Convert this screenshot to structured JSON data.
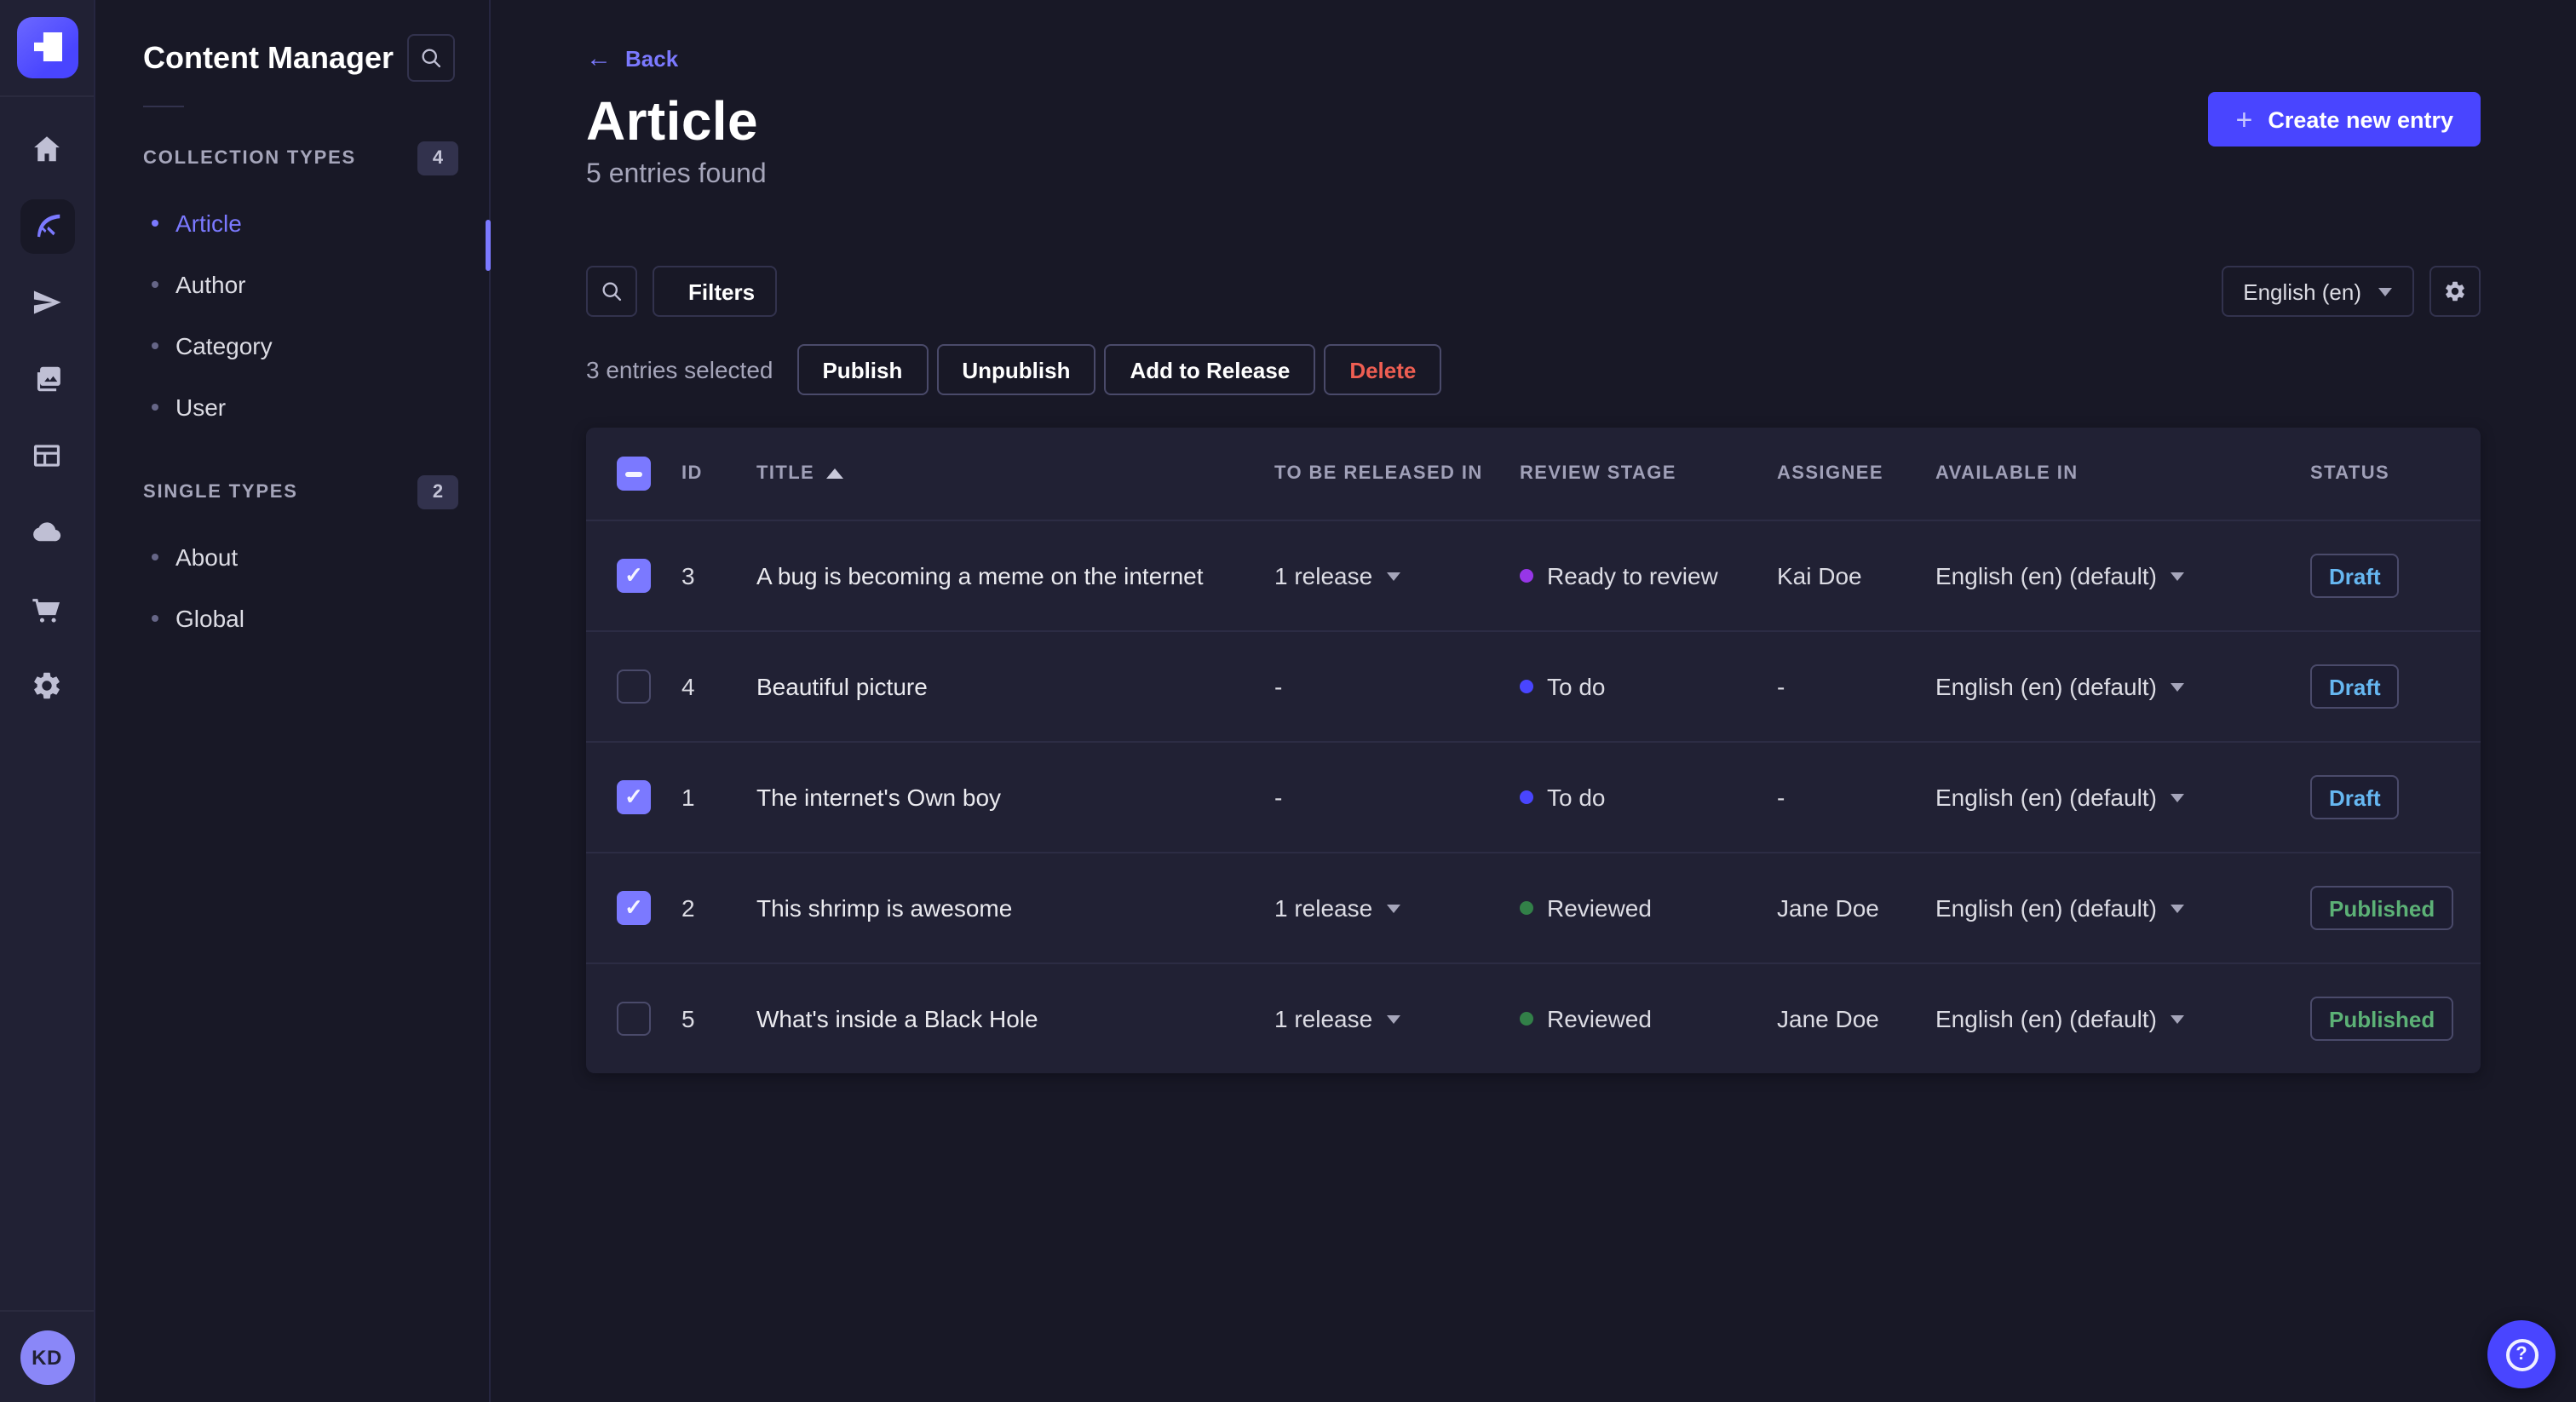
{
  "colors": {
    "primary": "#4945ff",
    "primary_light": "#7b79ff",
    "page_bg": "#181826",
    "card_bg": "#212134",
    "border": "#32324d",
    "text_muted": "#a5a5ba",
    "draft": "#66b7f1",
    "published": "#5cb176",
    "danger": "#ee5e52",
    "stage_todo": "#4945ff",
    "stage_ready": "#9736e8",
    "stage_reviewed": "#328048"
  },
  "rail": {
    "items": [
      "home",
      "content-manager",
      "releases",
      "media-library",
      "content-type-builder",
      "deploy",
      "marketplace",
      "settings"
    ],
    "active_item": "content-manager",
    "user_initials": "KD"
  },
  "subnav": {
    "title": "Content Manager",
    "sections": [
      {
        "label": "COLLECTION TYPES",
        "count": "4",
        "items": [
          {
            "label": "Article"
          },
          {
            "label": "Author"
          },
          {
            "label": "Category"
          },
          {
            "label": "User"
          }
        ],
        "active_item": "Article"
      },
      {
        "label": "SINGLE TYPES",
        "count": "2",
        "items": [
          {
            "label": "About"
          },
          {
            "label": "Global"
          }
        ]
      }
    ]
  },
  "header": {
    "back_label": "Back",
    "title": "Article",
    "subtitle": "5 entries found",
    "create_button": "Create new entry"
  },
  "toolbar": {
    "filters_label": "Filters",
    "locale": "English (en)"
  },
  "selection": {
    "text": "3 entries selected",
    "publish": "Publish",
    "unpublish": "Unpublish",
    "add_to_release": "Add to Release",
    "delete": "Delete"
  },
  "table": {
    "header_checkbox_state": "indeterminate",
    "columns": {
      "id": "ID",
      "title": "TITLE",
      "released": "TO BE RELEASED IN",
      "review": "REVIEW STAGE",
      "assignee": "ASSIGNEE",
      "available": "AVAILABLE IN",
      "status": "STATUS"
    },
    "sort": {
      "column": "TITLE",
      "direction": "asc"
    },
    "rows": [
      {
        "id": "3",
        "selected": true,
        "title": "A bug is becoming a meme on the internet",
        "released_in": "1 release",
        "has_release": true,
        "review_stage": {
          "label": "Ready to review",
          "key": "ready"
        },
        "assignee": "Kai Doe",
        "available_in": "English (en) (default)",
        "status": {
          "label": "Draft",
          "variant": "draft"
        }
      },
      {
        "id": "4",
        "selected": false,
        "title": "Beautiful picture",
        "released_in": "-",
        "has_release": false,
        "review_stage": {
          "label": "To do",
          "key": "todo"
        },
        "assignee": "-",
        "available_in": "English (en) (default)",
        "status": {
          "label": "Draft",
          "variant": "draft"
        }
      },
      {
        "id": "1",
        "selected": true,
        "title": "The internet's Own boy",
        "released_in": "-",
        "has_release": false,
        "review_stage": {
          "label": "To do",
          "key": "todo"
        },
        "assignee": "-",
        "available_in": "English (en) (default)",
        "status": {
          "label": "Draft",
          "variant": "draft"
        }
      },
      {
        "id": "2",
        "selected": true,
        "title": "This shrimp is awesome",
        "released_in": "1 release",
        "has_release": true,
        "review_stage": {
          "label": "Reviewed",
          "key": "reviewed"
        },
        "assignee": "Jane Doe",
        "available_in": "English (en) (default)",
        "status": {
          "label": "Published",
          "variant": "published"
        }
      },
      {
        "id": "5",
        "selected": false,
        "title": "What's inside a Black Hole",
        "released_in": "1 release",
        "has_release": true,
        "review_stage": {
          "label": "Reviewed",
          "key": "reviewed"
        },
        "assignee": "Jane Doe",
        "available_in": "English (en) (default)",
        "status": {
          "label": "Published",
          "variant": "published"
        }
      }
    ]
  },
  "help": {
    "glyph": "?"
  }
}
